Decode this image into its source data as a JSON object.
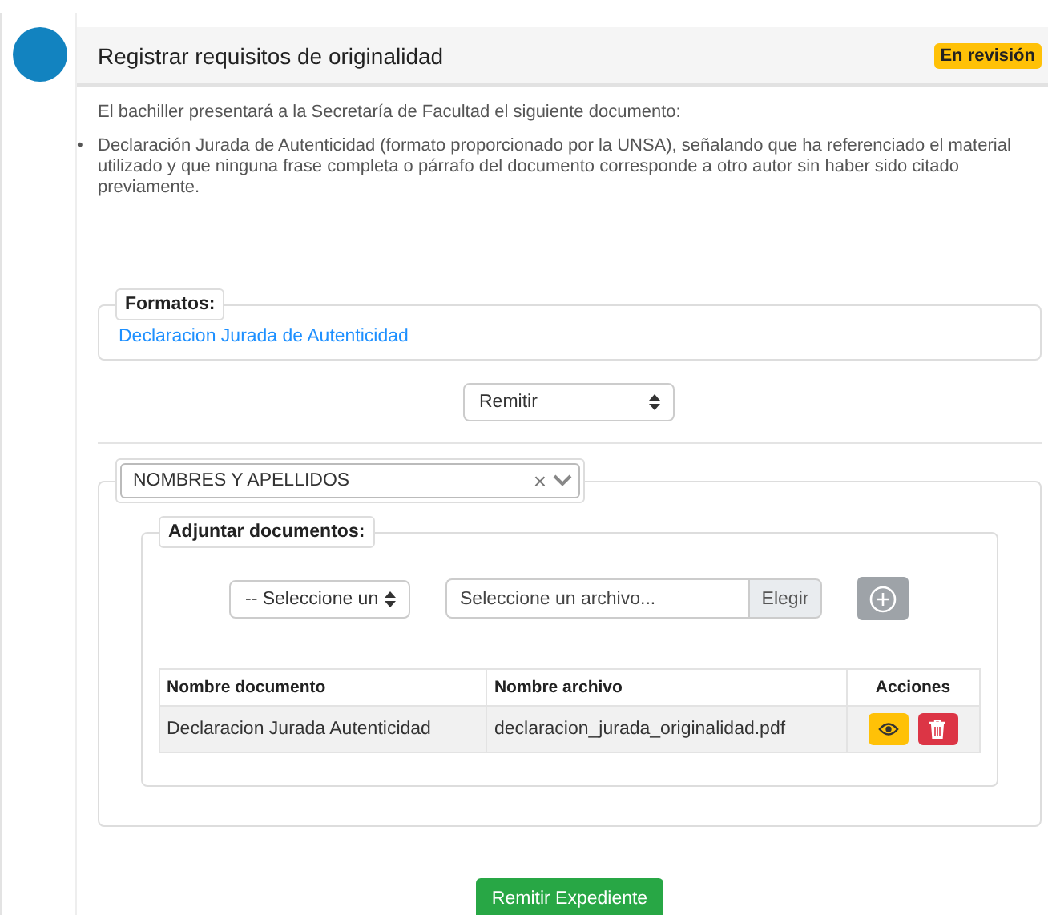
{
  "step": {
    "title": "Registrar requisitos de originalidad",
    "status": "En revisión"
  },
  "intro": "El bachiller presentará a la Secretaría de Facultad el siguiente documento:",
  "requirements": [
    {
      "bullet": "•",
      "text": "Declaración Jurada de Autenticidad (formato proporcionado por la UNSA), señalando que ha referenciado el material utilizado y que ninguna frase completa o párrafo del documento corresponde a otro autor sin haber sido citado previamente."
    }
  ],
  "formats": {
    "legend": "Formatos:",
    "links": [
      "Declaracion Jurada de Autenticidad"
    ]
  },
  "action_select": {
    "value": "Remitir"
  },
  "person_select": {
    "value": "NOMBRES Y APELLIDOS",
    "clear": "×"
  },
  "attach": {
    "legend": "Adjuntar documentos:",
    "type_select": {
      "value": "-- Seleccione un"
    },
    "file_field": {
      "placeholder": "Seleccione un archivo...",
      "button": "Elegir"
    },
    "add_enabled": false
  },
  "table": {
    "columns": [
      "Nombre documento",
      "Nombre archivo",
      "Acciones"
    ],
    "rows": [
      {
        "document": "Declaracion Jurada Autenticidad",
        "file": "declaracion_jurada_originalidad.pdf"
      }
    ]
  },
  "submit": "Remitir Expediente"
}
